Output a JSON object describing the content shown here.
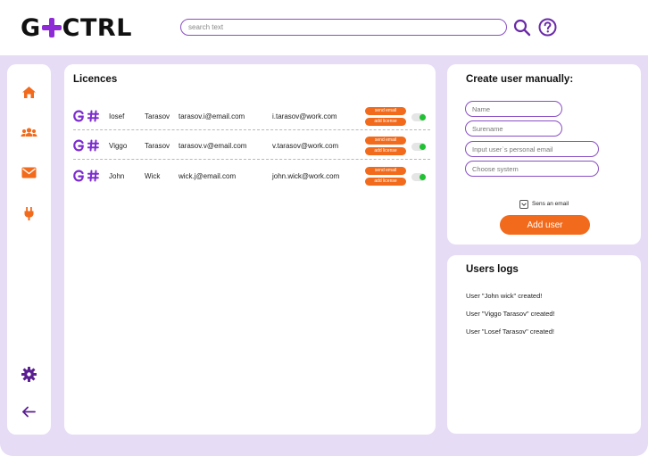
{
  "header": {
    "logo_left": "G",
    "logo_right": "CTRL",
    "search_placeholder": "search text"
  },
  "colors": {
    "accent_purple": "#8a4fc4",
    "accent_orange": "#f26a1b",
    "toggle_on": "#20c132",
    "background_lavender": "#e6dcf5"
  },
  "sidebar": {
    "items": [
      {
        "icon": "home-icon"
      },
      {
        "icon": "users-icon"
      },
      {
        "icon": "mail-icon"
      },
      {
        "icon": "plug-icon"
      }
    ],
    "bottom_items": [
      {
        "icon": "gear-icon"
      },
      {
        "icon": "arrow-left-icon"
      }
    ]
  },
  "licences": {
    "title": "Licences",
    "send_email_label": "send email",
    "add_license_label": "add license",
    "rows": [
      {
        "first": "Iosef",
        "last": "Tarasov",
        "email": "tarasov.i@email.com",
        "work_email": "i.tarasov@work.com",
        "enabled": true
      },
      {
        "first": "Viggo",
        "last": "Tarasov",
        "email": "tarasov.v@email.com",
        "work_email": "v.tarasov@work.com",
        "enabled": true
      },
      {
        "first": "John",
        "last": "Wick",
        "email": "wick.j@email.com",
        "work_email": "john.wick@work.com",
        "enabled": true
      }
    ]
  },
  "create_user": {
    "title": "Create user manually:",
    "name_placeholder": "Name",
    "surname_placeholder": "Surename",
    "email_placeholder": "Input user`s personal email",
    "system_placeholder": "Choose system",
    "send_email_label": "Sens an email",
    "send_email_checked": true,
    "add_button": "Add user"
  },
  "logs": {
    "title": "Users logs",
    "items": [
      "User \"John wick\" created!",
      "User \"Viggo Tarasov\" created!",
      "User \"Losef Tarasov\" created!"
    ]
  }
}
